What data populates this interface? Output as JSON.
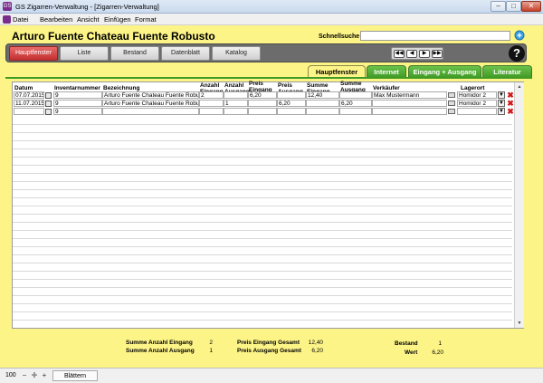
{
  "window": {
    "title": "GS Zigarren-Verwaltung - [Zigarren-Verwaltung]"
  },
  "menu": [
    "Datei",
    "Bearbeiten",
    "Ansicht",
    "Einfügen",
    "Format"
  ],
  "header": {
    "title": "Arturo Fuente Chateau Fuente Robusto",
    "search_label": "Schnellsuche",
    "search_value": ""
  },
  "nav": [
    "Hauptfenster",
    "Liste",
    "Bestand",
    "Datenblatt",
    "Katalog"
  ],
  "pager": [
    "◀◀",
    "◀",
    "▶",
    "▶▶"
  ],
  "help_label": "?",
  "tabs": [
    "Hauptfenster",
    "Internet",
    "Eingang + Ausgang",
    "Literatur"
  ],
  "columns": {
    "datum": "Datum",
    "inventar": "Inventarnummer",
    "bez": "Bezeichnung",
    "anz_ein": "Anzahl Eingang",
    "anz_aus": "Anzahl Ausgang",
    "preis_ein": "Preis Eingang",
    "preis_aus": "Preis Ausgang",
    "sum_ein": "Summe Eingang",
    "sum_aus": "Summe Ausgang",
    "verkaeufer": "Verkäufer",
    "lagerort": "Lagerort"
  },
  "rows": [
    {
      "datum": "07.07.2015",
      "inventar": "9",
      "bez": "Arturo Fuente Chateau Fuente Robusto",
      "anz_ein": "2",
      "anz_aus": "",
      "preis_ein": "6,20",
      "preis_aus": "",
      "sum_ein": "12,40",
      "sum_aus": "",
      "verkaeufer": "Max Mustermann",
      "lagerort": "Homidor 2"
    },
    {
      "datum": "11.07.2015",
      "inventar": "9",
      "bez": "Arturo Fuente Chateau Fuente Robusto",
      "anz_ein": "",
      "anz_aus": "1",
      "preis_ein": "",
      "preis_aus": "6,20",
      "sum_ein": "",
      "sum_aus": "6,20",
      "verkaeufer": "",
      "lagerort": "Homidor 2"
    },
    {
      "datum": "",
      "inventar": "9",
      "bez": "",
      "anz_ein": "",
      "anz_aus": "",
      "preis_ein": "",
      "preis_aus": "",
      "sum_ein": "",
      "sum_aus": "",
      "verkaeufer": "",
      "lagerort": ""
    }
  ],
  "summary": {
    "sum_anz_ein_label": "Summe Anzahl Eingang",
    "sum_anz_ein": "2",
    "sum_anz_aus_label": "Summe Anzahl Ausgang",
    "sum_anz_aus": "1",
    "preis_ein_label": "Preis Eingang Gesamt",
    "preis_ein": "12,40",
    "preis_aus_label": "Preis Ausgang Gesamt",
    "preis_aus": "6,20",
    "bestand_label": "Bestand",
    "bestand": "1",
    "wert_label": "Wert",
    "wert": "6,20"
  },
  "status": {
    "zoom": "100",
    "mode": "Blättern"
  },
  "colors": {
    "background": "#fdf487",
    "tab_green": "#3f9a26",
    "active_nav": "#c43030"
  }
}
